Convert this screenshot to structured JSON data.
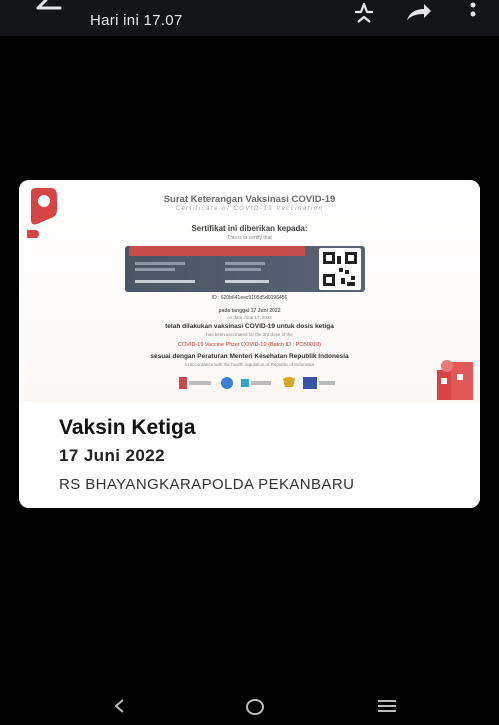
{
  "topbar": {
    "title": "Hari ini 17.07",
    "icons": [
      "back-arrow-icon",
      "star-icon",
      "share-icon",
      "more-vert-icon"
    ]
  },
  "certificate": {
    "title": "Surat Keterangan Vaksinasi COVID-19",
    "subtitle": "Certificate of COVID-19 Vaccination",
    "given_to": "Sertifikat ini diberikan kepada:",
    "certify": "This is to certify that",
    "id_line": "ID : 620b641eec9105d5d0196456",
    "date_line": "pada tanggal 17 Juni 2022",
    "date_line_en": "on date June 17, 2022",
    "dose_line": "telah dilakukan vaksinasi COVID-19 untuk dosis ketiga",
    "dose_line_en": "has been vaccinated for the 3rd dose of the",
    "vaccine_line": "COVID-19 Vaccine Pfizer COVID-19 (Batch ID : PCB0010)",
    "regulation_line": "sesuai dengan Peraturan Menteri Kesehatan Republik Indonesia",
    "regulation_line_en": "in accordance with the health regulation of Republic of Indonesia"
  },
  "vaccine": {
    "title": "Vaksin Ketiga",
    "date": "17 Juni 2022",
    "location": "RS BHAYANGKARAPOLDA PEKANBARU"
  },
  "navbar": {
    "icons": [
      "back-nav-icon",
      "home-nav-icon",
      "recents-nav-icon"
    ]
  },
  "colors": {
    "background": "#000000",
    "card": "#ffffff",
    "accent": "#d64545"
  }
}
